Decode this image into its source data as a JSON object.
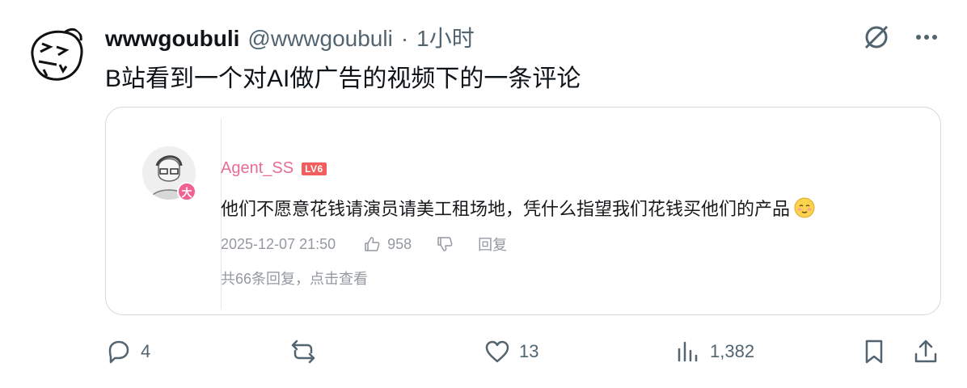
{
  "tweet": {
    "display_name": "wwwgoubuli",
    "handle": "@wwwgoubuli",
    "separator": "·",
    "time": "1小时",
    "text": "B站看到一个对AI做广告的视频下的一条评论"
  },
  "top_icons": [
    "grok-icon",
    "more-icon"
  ],
  "comment": {
    "username": "Agent_SS",
    "level": "LV6",
    "badge": "大",
    "text": "他们不愿意花钱请演员请美工租场地，凭什么指望我们花钱买他们的产品",
    "date": "2025-12-07 21:50",
    "likes": "958",
    "reply_label": "回复",
    "replies_summary": "共66条回复，点击查看"
  },
  "actions": {
    "replies": "4",
    "retweets": "",
    "likes": "13",
    "views": "1,382"
  },
  "colors": {
    "text": "#0f1419",
    "muted": "#536471",
    "bili_pink": "#e86c98",
    "bili_gray": "#9499a0",
    "border": "#cfd9de"
  }
}
